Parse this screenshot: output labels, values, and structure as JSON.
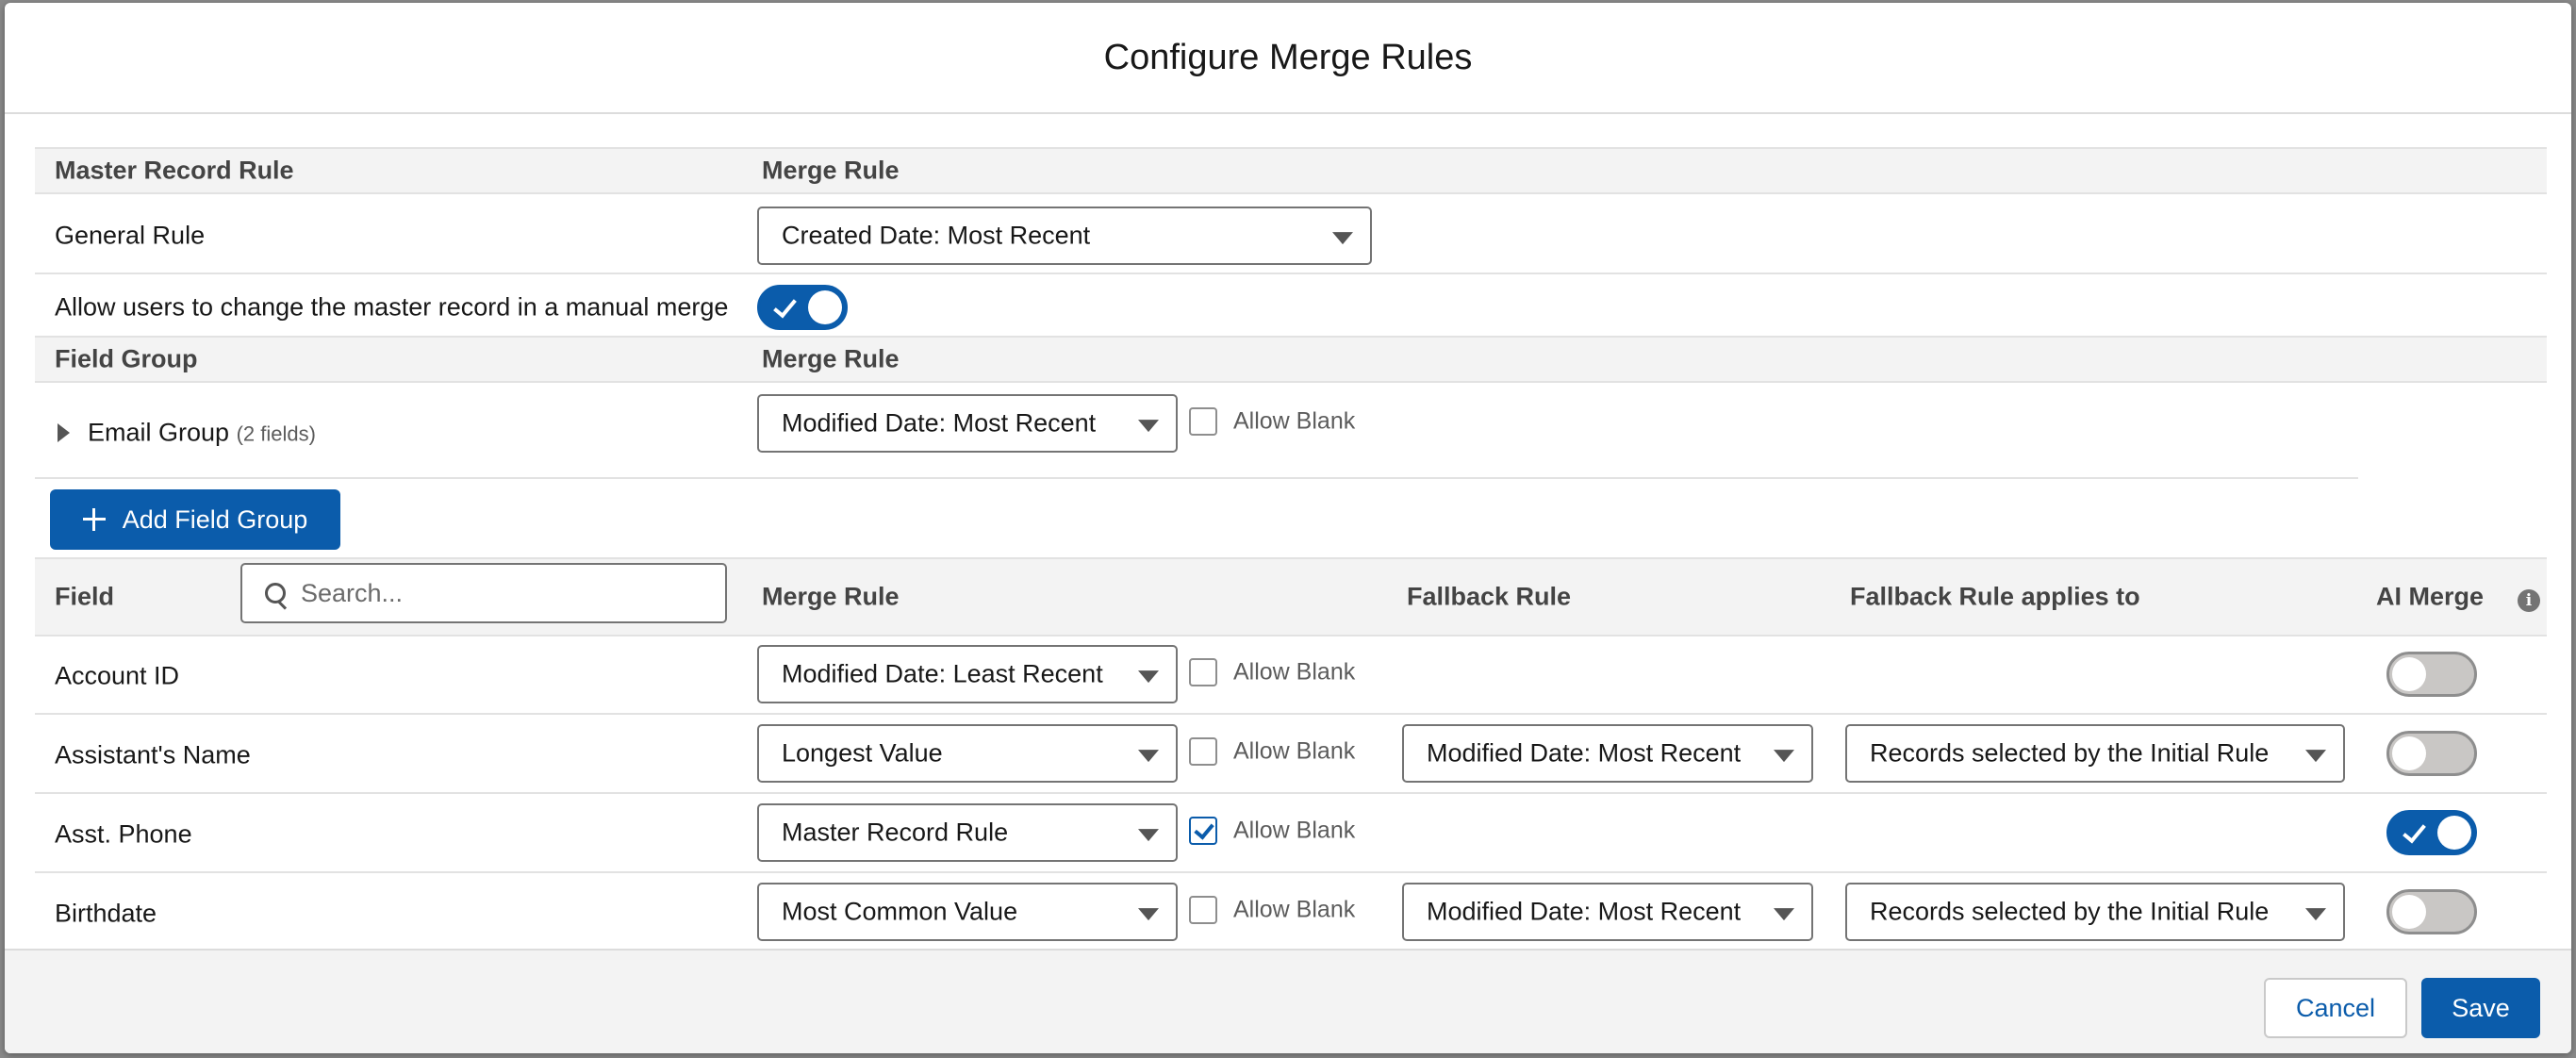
{
  "modal": {
    "title": "Configure Merge Rules"
  },
  "master": {
    "header_left": "Master Record Rule",
    "header_right": "Merge Rule",
    "general_label": "General Rule",
    "general_value": "Created Date: Most Recent",
    "allow_change_label": "Allow users to change the master record in a manual merge",
    "allow_change_on": true
  },
  "field_groups": {
    "header_left": "Field Group",
    "header_right": "Merge Rule",
    "items": [
      {
        "name": "Email Group",
        "count": "(2 fields)",
        "rule": "Modified Date: Most Recent",
        "allow_blank_label": "Allow Blank",
        "allow_blank": false
      }
    ],
    "add_button": "Add Field Group"
  },
  "fields": {
    "header_field": "Field",
    "search_placeholder": "Search...",
    "header_merge": "Merge Rule",
    "header_fallback": "Fallback Rule",
    "header_applies": "Fallback Rule applies to",
    "header_ai": "AI Merge",
    "info_glyph": "i",
    "rows": [
      {
        "name": "Account ID",
        "rule": "Modified Date: Least Recent",
        "allow_blank_label": "Allow Blank",
        "allow_blank": false,
        "fallback": "",
        "applies": "",
        "ai": false
      },
      {
        "name": "Assistant's Name",
        "rule": "Longest Value",
        "allow_blank_label": "Allow Blank",
        "allow_blank": false,
        "fallback": "Modified Date: Most Recent",
        "applies": "Records selected by the Initial Rule",
        "ai": false
      },
      {
        "name": "Asst. Phone",
        "rule": "Master Record Rule",
        "allow_blank_label": "Allow Blank",
        "allow_blank": true,
        "fallback": "",
        "applies": "",
        "ai": true
      },
      {
        "name": "Birthdate",
        "rule": "Most Common Value",
        "allow_blank_label": "Allow Blank",
        "allow_blank": false,
        "fallback": "Modified Date: Most Recent",
        "applies": "Records selected by the Initial Rule",
        "ai": false
      }
    ]
  },
  "footer": {
    "cancel": "Cancel",
    "save": "Save"
  },
  "colors": {
    "brand": "#0b5cab",
    "header_bg": "#f3f3f3",
    "border": "#e2e2e2"
  }
}
